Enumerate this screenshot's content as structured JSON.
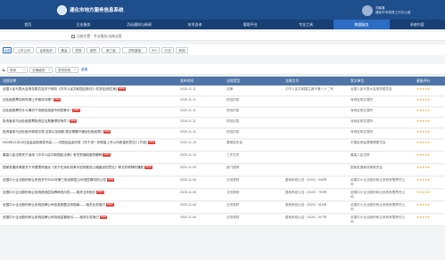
{
  "header": {
    "site_title": "通化市地方服务信息系统",
    "user_name": "刘某某",
    "user_org": "通化市市政府工作办公室"
  },
  "nav": [
    {
      "label": "首页",
      "active": false
    },
    {
      "label": "企业服务",
      "active": false
    },
    {
      "label": "活动通知与新闻",
      "active": false
    },
    {
      "label": "技术咨询",
      "active": false
    },
    {
      "label": "援助平台",
      "active": false
    },
    {
      "label": "专业工具",
      "active": false
    },
    {
      "label": "数据服务",
      "active": true
    },
    {
      "label": "系统内容",
      "active": false
    }
  ],
  "breadcrumb": "当前位置：专业服务/法律法规",
  "categories": [
    "全部",
    "上市公司",
    "证券投资",
    "基金",
    "债券",
    "期货",
    "新三板",
    "并购重组",
    "IPO",
    "行业",
    "其他"
  ],
  "filters": {
    "sort_label": "排序",
    "type_label": "法律级别",
    "issuer_label": "发布机构",
    "reset_label": "重置"
  },
  "table_headers": [
    "法规名称",
    "发布时间",
    "法规类型",
    "法规文号",
    "发文单位",
    "星级评价"
  ],
  "new_tag": "NEW",
  "rows": [
    {
      "title": "全国人民代表大会常务委员会关于修改《中华人民共和国证券法》的决定(修正案)",
      "date": "2020-11-11",
      "type": "法律",
      "number": "中华人民共和国主席令第八十二号",
      "issuer": "全国人民代表大会常务委员会",
      "stars": "★★★★★",
      "has_new": true
    },
    {
      "title": "创业板股票如何申请上市程序办理?",
      "date": "2020-11-11",
      "type": "热线问答",
      "number": "",
      "issuer": "深圳证券交易所",
      "stars": "★★★★★",
      "has_new": true
    },
    {
      "title": "创业板股票在什么情况下将被实施退市风险警示?",
      "date": "2020-11-11",
      "type": "热线问答",
      "number": "",
      "issuer": "深圳证券交易所",
      "stars": "★★★★★",
      "has_new": true
    },
    {
      "title": "投资者参与创业板股票投资应当具备哪些条件?",
      "date": "2020-11-11",
      "type": "热线问答",
      "number": "",
      "issuer": "深圳证券交易所",
      "stars": "★★★★★",
      "has_new": true
    },
    {
      "title": "投资者参与创业板可转债交易,交易以及转股,是否需要开通创业板权限?",
      "date": "2020-11-11",
      "type": "热线问答",
      "number": "",
      "issuer": "深圳证券交易所",
      "stars": "★★★★★",
      "has_new": true
    },
    {
      "title": "2020年11月10日证监会新闻发布会——中国证监会印发《关于进一步提高上市公司质量的意见》(节选)",
      "date": "2020-11-10",
      "type": "要闻发布会",
      "number": "",
      "issuer": "中国证券监督管理委员会",
      "stars": "★★★★★",
      "has_new": true
    },
    {
      "title": "最高人民法院关于适用《中华人民共和国民法典》有关担保制度的解释",
      "date": "2020-11-10",
      "type": "工作文件",
      "number": "",
      "issuer": "最高人民法院",
      "stars": "★★★★★",
      "has_new": true
    },
    {
      "title": "国家发展改革委关于开展贯彻落实《关于在深化改革中加快推进公路建设的意见》等文件精神的通知",
      "date": "2020-11-09",
      "type": "部门规章",
      "number": "",
      "issuer": "国家发展和改革委员会",
      "stars": "★★★★★",
      "has_new": true
    },
    {
      "title": "全国中小企业股份转让系统关于2020年第三批创新层公司进层情况的公告",
      "date": "2020-11-06",
      "type": "业务规则",
      "number": "股转系统公告〔2020〕908号",
      "issuer": "全国中小企业股份转让系统有限责任公司",
      "stars": "★★★★★",
      "has_new": true
    },
    {
      "title": "全国中小企业股份转让系统精选层挂牌审查问答——相关业务指引",
      "date": "2020-11-06",
      "type": "业务规则",
      "number": "股转系统公告〔2020〕794号",
      "issuer": "全国中小企业股份转让系统有限责任公司",
      "stars": "★★★★★",
      "has_new": true
    },
    {
      "title": "全国中小企业股份转让系统挂牌公司信息披露业务指南——相关业务指引",
      "date": "2020-11-06",
      "type": "业务规则",
      "number": "股转系统公告〔2020〕816号",
      "issuer": "全国中小企业股份转让系统有限责任公司",
      "stars": "★★★★★",
      "has_new": true
    },
    {
      "title": "全国中小企业股份转让系统挂牌公司持续监管指引——相关业务指引",
      "date": "2020-11-06",
      "type": "业务规则",
      "number": "股转系统公告〔2020〕817号",
      "issuer": "全国中小企业股份转让系统有限责任公司",
      "stars": "★★★★★",
      "has_new": true
    }
  ],
  "colors": {
    "header": "#1f4e8c",
    "nav": "#173f73",
    "nav_active": "#2b6cc4",
    "table_head": "#4e74a8",
    "tag": "#e2453c",
    "star": "#f0a020"
  }
}
